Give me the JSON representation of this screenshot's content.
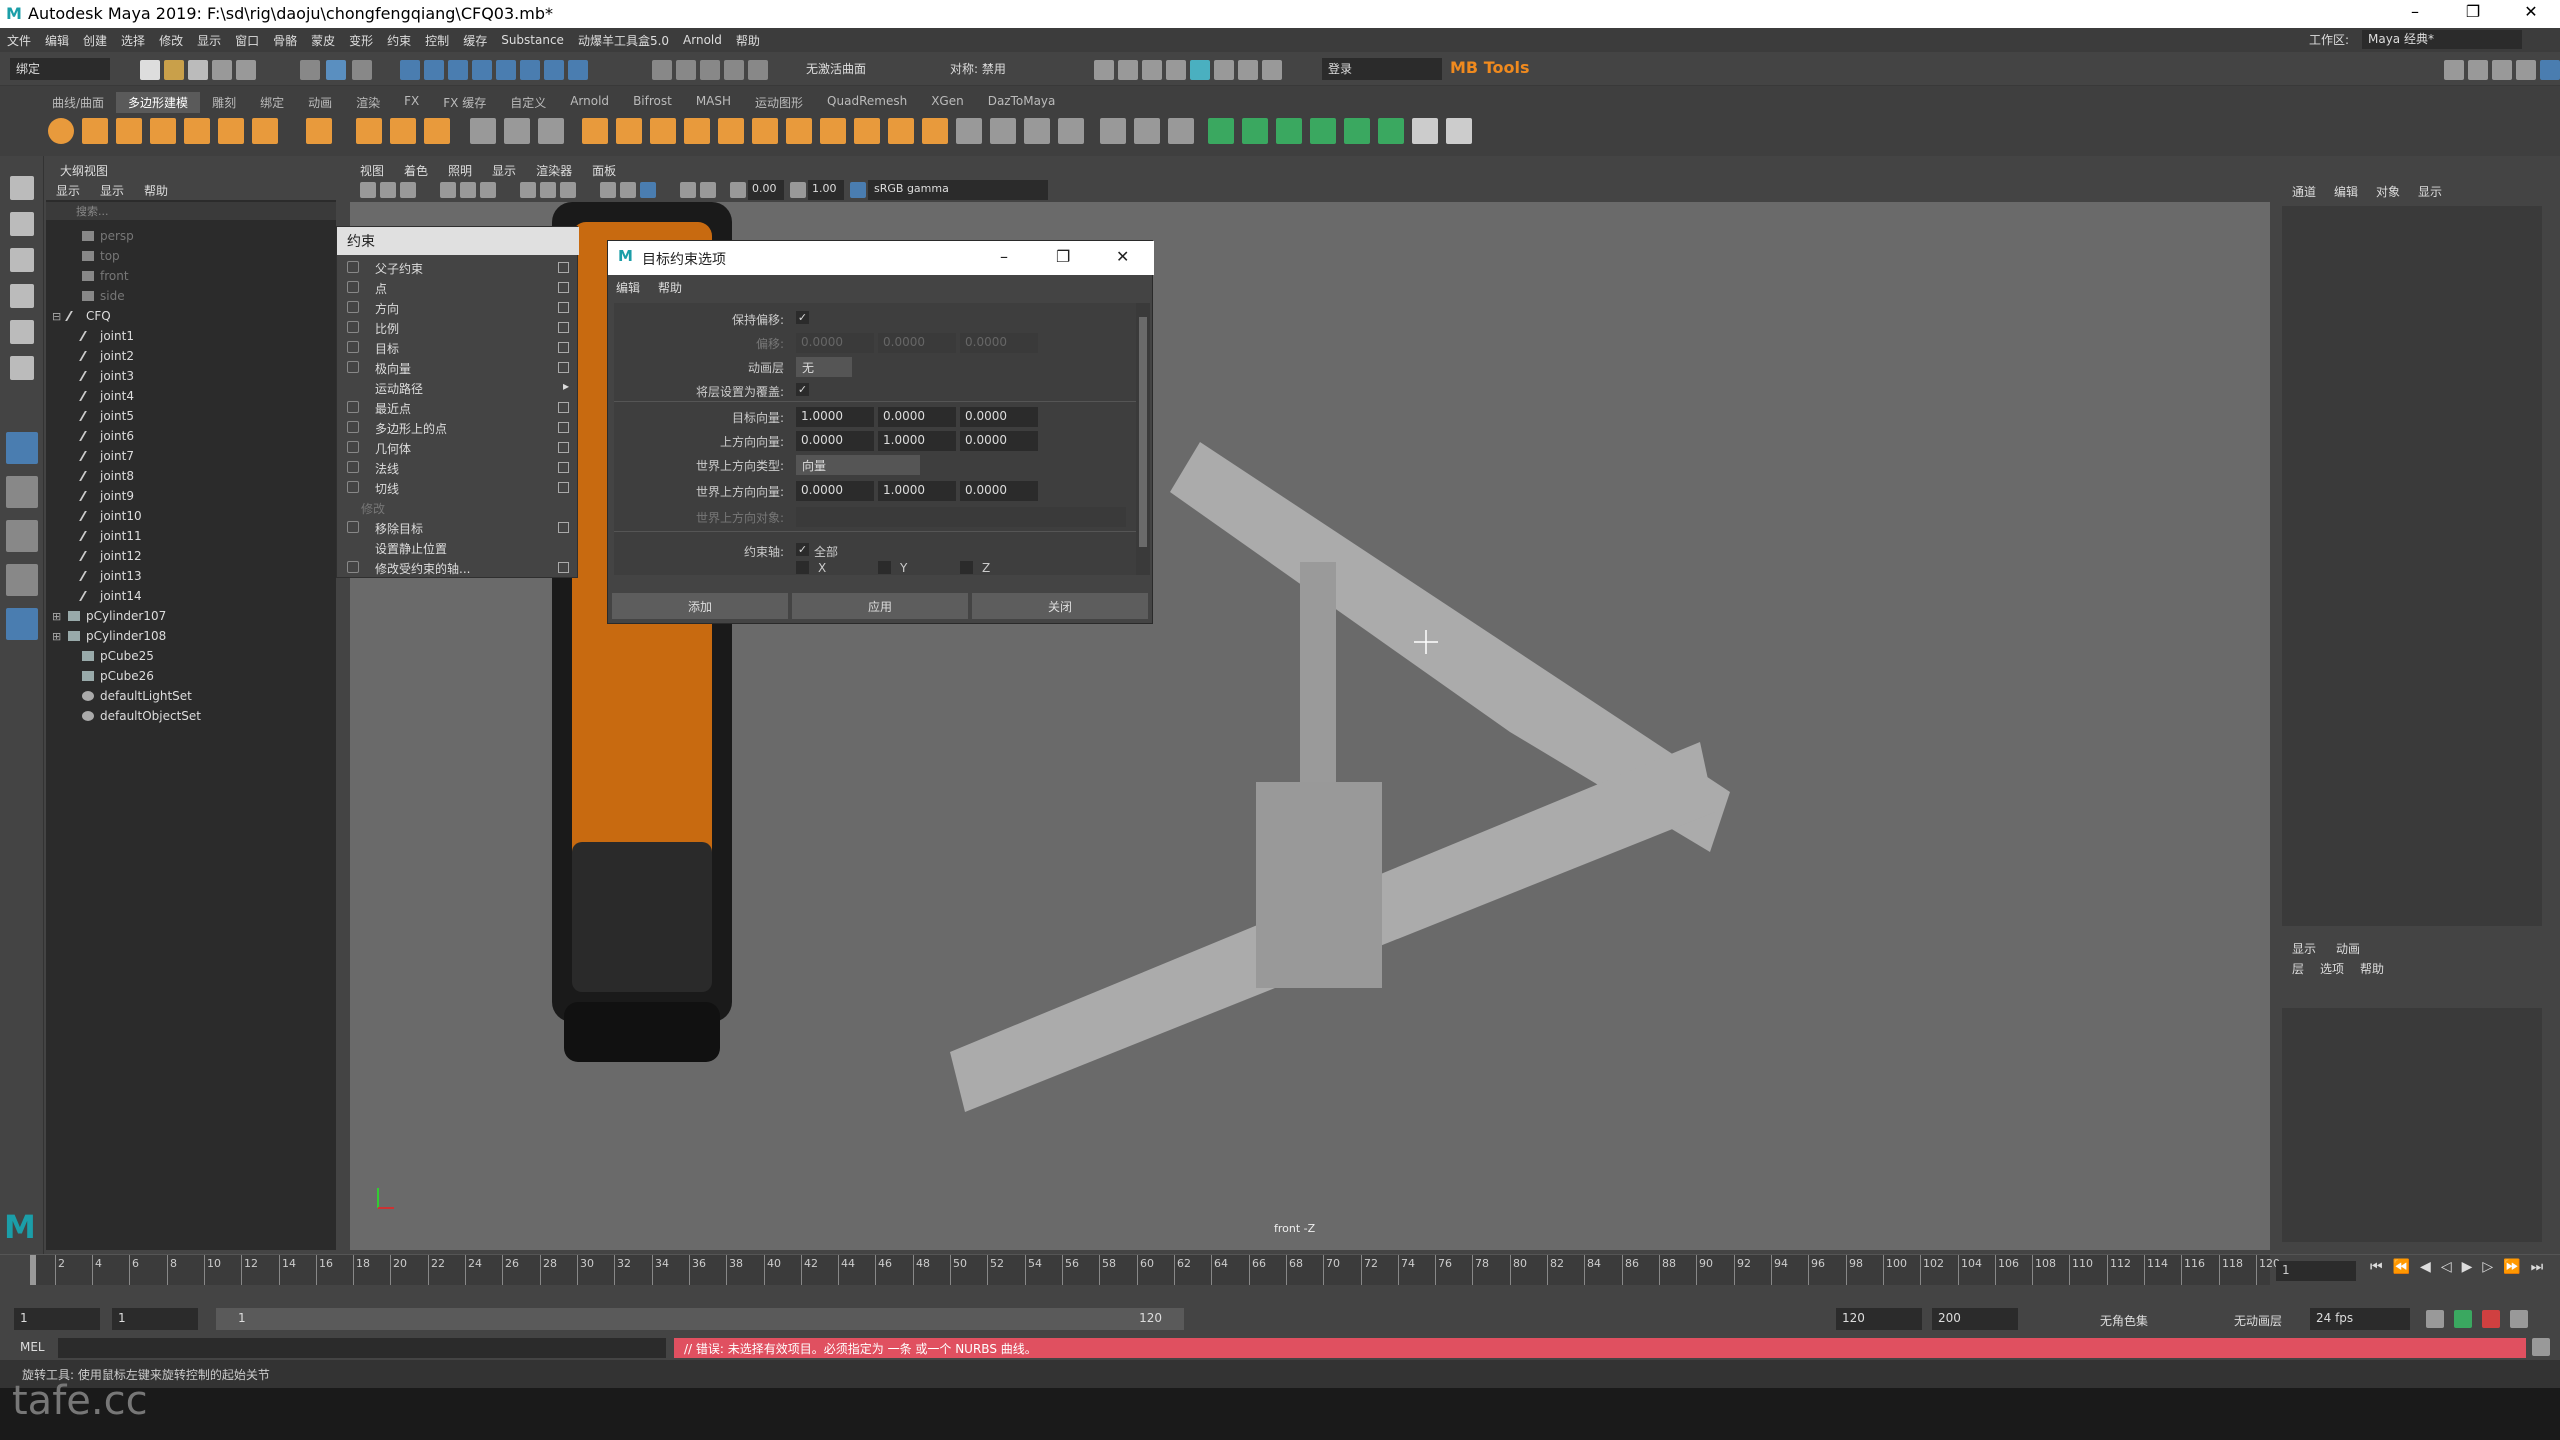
{
  "title": "Autodesk Maya 2019: F:\\sd\\rig\\daoju\\chongfengqiang\\CFQ03.mb*",
  "window_buttons": [
    "–",
    "❐",
    "✕"
  ],
  "menu": [
    "文件",
    "编辑",
    "创建",
    "选择",
    "修改",
    "显示",
    "窗口",
    "骨骼",
    "蒙皮",
    "变形",
    "约束",
    "控制",
    "缓存",
    "Substance",
    "动爆羊工具盒5.0",
    "Arnold",
    "帮助"
  ],
  "workspace": {
    "label": "工作区:",
    "value": "Maya 经典*"
  },
  "toolbar": {
    "mode": "绑定",
    "no_live": "无激活曲面",
    "symmetry": "对称: 禁用",
    "login": "登录",
    "mbtools": "MB Tools"
  },
  "shelf_tabs": [
    "曲线/曲面",
    "多边形建模",
    "雕刻",
    "绑定",
    "动画",
    "渲染",
    "FX",
    "FX 缓存",
    "自定义",
    "Arnold",
    "Bifrost",
    "MASH",
    "运动图形",
    "QuadRemesh",
    "XGen",
    "DazToMaya"
  ],
  "outliner": {
    "title": "大纲视图",
    "menu": [
      "显示",
      "显示",
      "帮助"
    ],
    "search": "搜索...",
    "items": [
      {
        "name": "persp",
        "dim": true,
        "indent": 1,
        "icon": "camera-icon"
      },
      {
        "name": "top",
        "dim": true,
        "indent": 1,
        "icon": "camera-icon"
      },
      {
        "name": "front",
        "dim": true,
        "indent": 1,
        "icon": "camera-icon"
      },
      {
        "name": "side",
        "dim": true,
        "indent": 1,
        "icon": "camera-icon"
      },
      {
        "name": "CFQ",
        "dim": false,
        "indent": 0,
        "icon": "joint-icon",
        "expand": "⊟"
      },
      {
        "name": "joint1",
        "dim": false,
        "indent": 1,
        "icon": "joint-icon"
      },
      {
        "name": "joint2",
        "dim": false,
        "indent": 1,
        "icon": "joint-icon"
      },
      {
        "name": "joint3",
        "dim": false,
        "indent": 1,
        "icon": "joint-icon"
      },
      {
        "name": "joint4",
        "dim": false,
        "indent": 1,
        "icon": "joint-icon"
      },
      {
        "name": "joint5",
        "dim": false,
        "indent": 1,
        "icon": "joint-icon"
      },
      {
        "name": "joint6",
        "dim": false,
        "indent": 1,
        "icon": "joint-icon"
      },
      {
        "name": "joint7",
        "dim": false,
        "indent": 1,
        "icon": "joint-icon"
      },
      {
        "name": "joint8",
        "dim": false,
        "indent": 1,
        "icon": "joint-icon"
      },
      {
        "name": "joint9",
        "dim": false,
        "indent": 1,
        "icon": "joint-icon"
      },
      {
        "name": "joint10",
        "dim": false,
        "indent": 1,
        "icon": "joint-icon"
      },
      {
        "name": "joint11",
        "dim": false,
        "indent": 1,
        "icon": "joint-icon"
      },
      {
        "name": "joint12",
        "dim": false,
        "indent": 1,
        "icon": "joint-icon"
      },
      {
        "name": "joint13",
        "dim": false,
        "indent": 1,
        "icon": "joint-icon"
      },
      {
        "name": "joint14",
        "dim": false,
        "indent": 1,
        "icon": "joint-icon"
      },
      {
        "name": "pCylinder107",
        "dim": false,
        "indent": 0,
        "icon": "mesh-icon",
        "expand": "⊞"
      },
      {
        "name": "pCylinder108",
        "dim": false,
        "indent": 0,
        "icon": "mesh-icon",
        "expand": "⊞"
      },
      {
        "name": "pCube25",
        "dim": false,
        "indent": 1,
        "icon": "mesh-icon"
      },
      {
        "name": "pCube26",
        "dim": false,
        "indent": 1,
        "icon": "mesh-icon"
      },
      {
        "name": "defaultLightSet",
        "dim": false,
        "indent": 1,
        "icon": "set-icon"
      },
      {
        "name": "defaultObjectSet",
        "dim": false,
        "indent": 1,
        "icon": "set-icon"
      }
    ]
  },
  "viewport": {
    "menu": [
      "视图",
      "着色",
      "照明",
      "显示",
      "渲染器",
      "面板"
    ],
    "field1": "0.00",
    "field2": "1.00",
    "colorspace": "sRGB gamma",
    "camera_label": "front -Z"
  },
  "constrain_menu": {
    "title": "约束",
    "items": [
      {
        "label": "父子约束",
        "type": "opt"
      },
      {
        "label": "点",
        "type": "opt"
      },
      {
        "label": "方向",
        "type": "opt"
      },
      {
        "label": "比例",
        "type": "opt"
      },
      {
        "label": "目标",
        "type": "opt"
      },
      {
        "label": "极向量",
        "type": "opt"
      },
      {
        "label": "运动路径",
        "type": "sub"
      },
      {
        "label": "最近点",
        "type": "opt"
      },
      {
        "label": "多边形上的点",
        "type": "opt"
      },
      {
        "label": "几何体",
        "type": "opt"
      },
      {
        "label": "法线",
        "type": "opt"
      },
      {
        "label": "切线",
        "type": "opt"
      },
      {
        "label": "修改",
        "type": "section"
      },
      {
        "label": "移除目标",
        "type": "opt"
      },
      {
        "label": "设置静止位置",
        "type": "plain"
      },
      {
        "label": "修改受约束的轴...",
        "type": "opt"
      }
    ]
  },
  "dialog": {
    "title": "目标约束选项",
    "menu": [
      "编辑",
      "帮助"
    ],
    "maintain_offset": "保持偏移:",
    "offset": "偏移:",
    "offset_vals": [
      "0.0000",
      "0.0000",
      "0.0000"
    ],
    "anim_layer": "动画层",
    "anim_layer_val": "无",
    "override": "将层设置为覆盖:",
    "aim_vector": "目标向量:",
    "aim_vals": [
      "1.0000",
      "0.0000",
      "0.0000"
    ],
    "up_vector": "上方向向量:",
    "up_vals": [
      "0.0000",
      "1.0000",
      "0.0000"
    ],
    "world_up_type": "世界上方向类型:",
    "world_up_type_val": "向量",
    "world_up_vector": "世界上方向向量:",
    "world_up_vals": [
      "0.0000",
      "1.0000",
      "0.0000"
    ],
    "world_up_object": "世界上方向对象:",
    "constraint_axes": "约束轴:",
    "all": "全部",
    "x": "X",
    "y": "Y",
    "z": "Z",
    "btn_add": "添加",
    "btn_apply": "应用",
    "btn_close": "关闭"
  },
  "channelbox": {
    "menu": [
      "通道",
      "编辑",
      "对象",
      "显示"
    ],
    "layer_tabs": [
      "显示",
      "动画"
    ],
    "layer_menu": [
      "层",
      "选项",
      "帮助"
    ]
  },
  "timeline": {
    "ticks": [
      2,
      4,
      6,
      8,
      10,
      12,
      14,
      16,
      18,
      20,
      22,
      24,
      26,
      28,
      30,
      32,
      34,
      36,
      38,
      40,
      42,
      44,
      46,
      48,
      50,
      52,
      54,
      56,
      58,
      60,
      62,
      64,
      66,
      68,
      70,
      72,
      74,
      76,
      78,
      80,
      82,
      84,
      86,
      88,
      90,
      92,
      94,
      96,
      98,
      100,
      102,
      104,
      106,
      108,
      110,
      112,
      114,
      116,
      118,
      120
    ],
    "first": "1",
    "current": "1"
  },
  "range": {
    "start": "1",
    "start2": "1",
    "slider_start": "1",
    "slider_end": "120",
    "end": "120",
    "end2": "200",
    "no_char": "无角色集",
    "no_layer": "无动画层",
    "fps": "24 fps"
  },
  "cmd": {
    "label": "MEL",
    "error": "// 错误: 未选择有效项目。必须指定为 一条 或一个 NURBS 曲线。"
  },
  "help": "旋转工具: 使用鼠标左键来旋转控制的起始关节",
  "watermark": "tafe.cc"
}
